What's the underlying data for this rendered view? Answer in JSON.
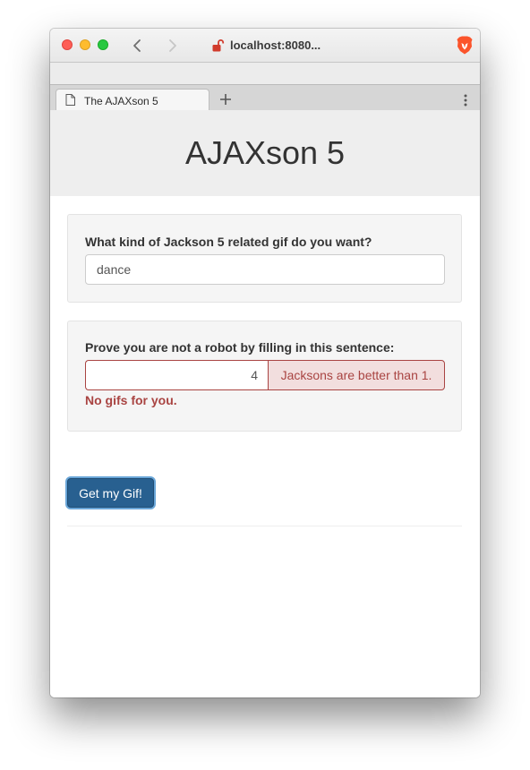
{
  "browser": {
    "address": "localhost:8080...",
    "tab_title": "The AJAXson 5"
  },
  "page": {
    "title": "AJAXson 5",
    "gif_question": {
      "label": "What kind of Jackson 5 related gif do you want?",
      "value": "dance"
    },
    "robot_check": {
      "label": "Prove you are not a robot by filling in this sentence:",
      "value": "4",
      "addon_text": "Jacksons are better than 1.",
      "error_text": "No gifs for you."
    },
    "submit_label": "Get my Gif!"
  },
  "colors": {
    "primary_button": "#286090",
    "error_text": "#a94442",
    "error_background": "#f2dede",
    "jumbotron": "#eeeeee"
  },
  "icons": [
    "back-icon",
    "forward-icon",
    "unlocked-icon",
    "brave-lion-icon",
    "page-icon",
    "plus-icon",
    "more-vertical-icon"
  ]
}
